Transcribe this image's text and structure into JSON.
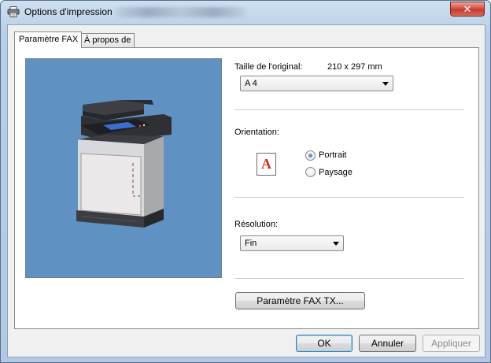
{
  "window": {
    "title": "Options d'impression",
    "icon": "printer-icon",
    "close_glyph": "✕"
  },
  "tabs": [
    {
      "label": "Paramètre FAX",
      "active": true
    },
    {
      "label": "À propos de",
      "active": false
    }
  ],
  "preview": {
    "image": "multifunction-printer-illustration",
    "background": "#5f92c2"
  },
  "original_size": {
    "label": "Taille de l'original:",
    "dimensions": "210 x 297 mm",
    "selected": "A 4"
  },
  "orientation": {
    "label": "Orientation:",
    "icon_glyph": "A",
    "options": [
      {
        "label": "Portrait",
        "checked": true
      },
      {
        "label": "Paysage",
        "checked": false
      }
    ]
  },
  "resolution": {
    "label": "Résolution:",
    "selected": "Fin"
  },
  "fax_settings_button": "Paramètre FAX TX...",
  "footer": {
    "ok": "OK",
    "cancel": "Annuler",
    "apply": "Appliquer"
  },
  "colors": {
    "close_button": "#c83c2c",
    "default_button_border": "#3c7fb1",
    "orientation_letter": "#c8341d"
  }
}
